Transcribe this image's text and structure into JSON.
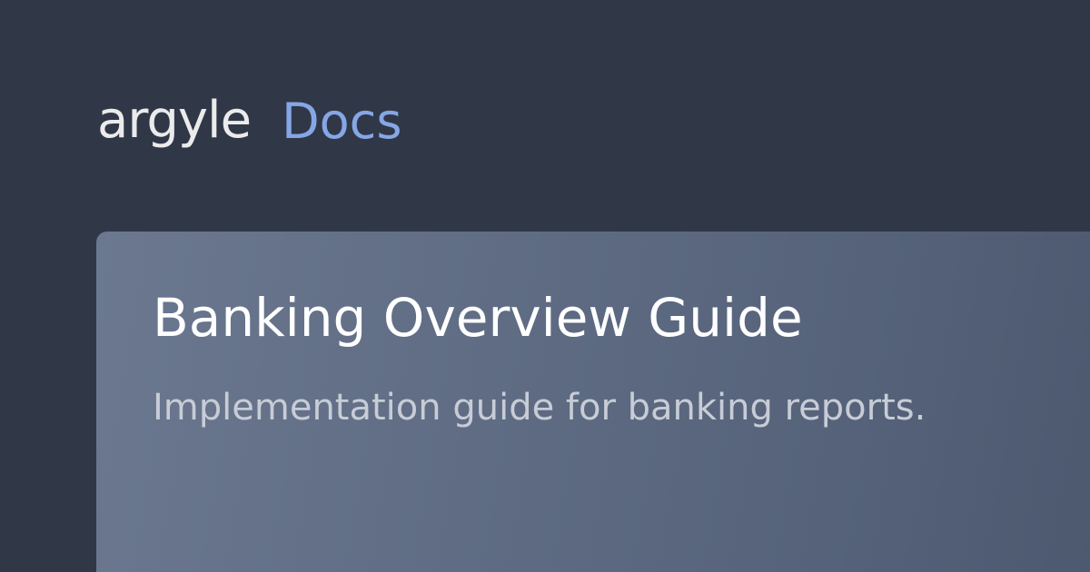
{
  "header": {
    "brand": "argyle",
    "section": "Docs"
  },
  "card": {
    "title": "Banking Overview Guide",
    "subtitle": "Implementation guide for banking reports."
  },
  "colors": {
    "background": "#303848",
    "brand_text": "#ebebec",
    "accent": "#86a6e6",
    "card_gradient_start": "#6b7890",
    "card_gradient_end": "#4d596f",
    "title_text": "#ffffff",
    "subtitle_text": "#c7ccd6"
  }
}
